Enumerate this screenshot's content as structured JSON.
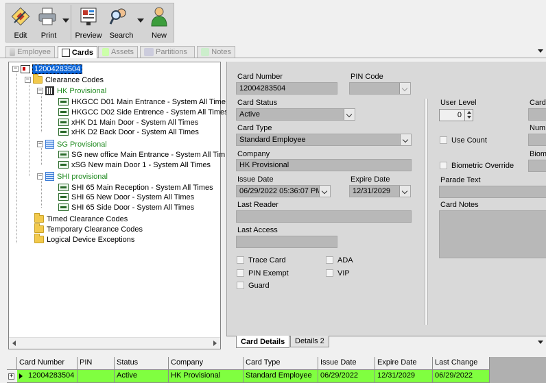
{
  "toolbar": {
    "edit": "Edit",
    "print": "Print",
    "preview": "Preview",
    "search": "Search",
    "new": "New"
  },
  "tabs": {
    "employee": "Employee",
    "cards": "Cards",
    "assets": "Assets",
    "partitions": "Partitions",
    "notes": "Notes"
  },
  "tree": {
    "root": "12004283504",
    "clearance_codes": "Clearance Codes",
    "hk_provisional": "HK Provisional",
    "hk_doors": [
      "HKGCC D01 Main Entrance - System All Time",
      "HKGCC D02 Side Entrence - System All Times",
      "xHK D1 Main Door - System All Times",
      "xHK D2 Back Door - System All Times"
    ],
    "sg_provisional": "SG Provisional",
    "sg_doors": [
      "SG new office Main Entrance - System All Tim",
      "xSG New main Door 1 - System All Times"
    ],
    "shi_provisional": "SHI provisional",
    "shi_doors": [
      "SHI 65 Main Reception - System All Times",
      "SHI 65 New Door - System All Times",
      "SHI 65 Side Door - System All Times"
    ],
    "timed": "Timed Clearance Codes",
    "temporary": "Temporary Clearance Codes",
    "logical": "Logical Device Exceptions"
  },
  "detail": {
    "card_number_label": "Card Number",
    "card_number": "12004283504",
    "pin_code_label": "PIN Code",
    "pin_code": "",
    "card_status_label": "Card Status",
    "card_status": "Active",
    "card_type_label": "Card Type",
    "card_type": "Standard Employee",
    "company_label": "Company",
    "company": "HK Provisional",
    "issue_date_label": "Issue Date",
    "issue_date": "06/29/2022 05:36:07 PM",
    "expire_date_label": "Expire Date",
    "expire_date": "12/31/2029",
    "last_reader_label": "Last Reader",
    "last_reader": "",
    "last_access_label": "Last Access",
    "last_access": "",
    "trace_card": "Trace Card",
    "pin_exempt": "PIN Exempt",
    "guard": "Guard",
    "ada": "ADA",
    "vip": "VIP",
    "user_level_label": "User Level",
    "user_level": "0",
    "use_count": "Use Count",
    "biometric_override": "Biometric Override",
    "parade_text_label": "Parade Text",
    "card_notes_label": "Card Notes",
    "card_cut_label": "Card",
    "numb_cut_label": "Numb",
    "biom_cut_label": "Biom"
  },
  "bottom_tabs": {
    "card_details": "Card Details",
    "details2": "Details 2"
  },
  "grid": {
    "headers": [
      "Card Number",
      "PIN",
      "Status",
      "Company",
      "Card Type",
      "Issue Date",
      "Expire Date",
      "Last Change"
    ],
    "row": [
      "12004283504",
      "",
      "Active",
      "HK Provisional",
      "Standard Employee",
      "06/29/2022",
      "12/31/2029",
      "06/29/2022"
    ]
  }
}
